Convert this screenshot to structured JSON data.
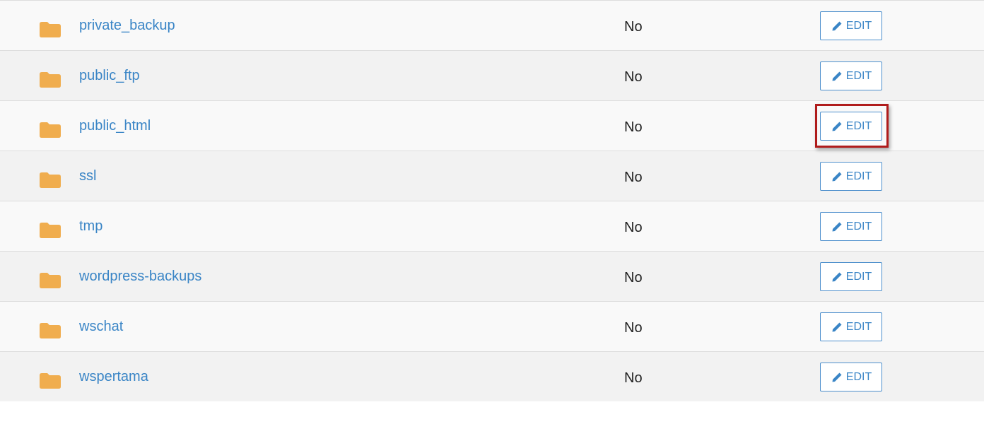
{
  "directories": [
    {
      "name": "private_backup",
      "value": "No",
      "edit_label": "EDIT"
    },
    {
      "name": "public_ftp",
      "value": "No",
      "edit_label": "EDIT"
    },
    {
      "name": "public_html",
      "value": "No",
      "edit_label": "EDIT"
    },
    {
      "name": "ssl",
      "value": "No",
      "edit_label": "EDIT"
    },
    {
      "name": "tmp",
      "value": "No",
      "edit_label": "EDIT"
    },
    {
      "name": "wordpress-backups",
      "value": "No",
      "edit_label": "EDIT"
    },
    {
      "name": "wschat",
      "value": "No",
      "edit_label": "EDIT"
    },
    {
      "name": "wspertama",
      "value": "No",
      "edit_label": "EDIT"
    }
  ],
  "icons": {
    "folder": "folder-icon",
    "edit": "pencil-icon"
  },
  "colors": {
    "folder": "#f0ad4e",
    "link": "#3a85c6",
    "highlight": "#b01c1c"
  }
}
